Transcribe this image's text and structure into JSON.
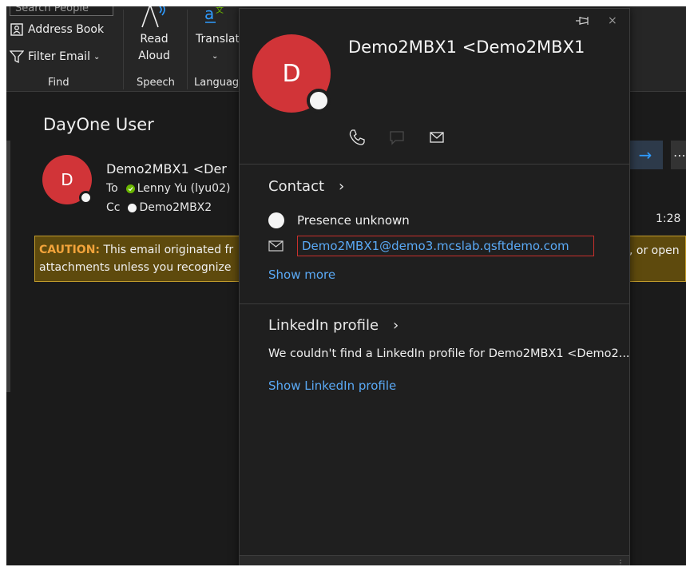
{
  "ribbon": {
    "search_placeholder": "Search People",
    "address_book": "Address Book",
    "filter_email": "Filter Email",
    "group_find": "Find",
    "read_aloud_1": "Read",
    "read_aloud_2": "Aloud",
    "group_speech": "Speech",
    "translate": "Translat",
    "group_language": "Languag"
  },
  "message": {
    "subject": "DayOne User",
    "sender_initial": "D",
    "sender_name": "Demo2MBX1 <Der",
    "to_label": "To",
    "to_value": "Lenny Yu (lyu02)",
    "cc_label": "Cc",
    "cc_value": "Demo2MBX2",
    "time": "1:28",
    "caution_lead": "CAUTION:",
    "caution_text1": " This email originated fr",
    "caution_text2": "attachments unless you recognize",
    "caution_right": ", or open"
  },
  "card": {
    "initial": "D",
    "name": "Demo2MBX1 <Demo2MBX1",
    "contact_title": "Contact",
    "presence": "Presence unknown",
    "email": "Demo2MBX1@demo3.mcslab.qsftdemo.com",
    "show_more": "Show more",
    "linkedin_title": "LinkedIn profile",
    "linkedin_text": "We couldn't find a LinkedIn profile for Demo2MBX1 <Demo2...",
    "show_linkedin": "Show LinkedIn profile"
  },
  "colors": {
    "avatar": "#d13438",
    "link": "#5aa9f5",
    "highlight_border": "#c8302c",
    "caution_bg": "#5e4a0d"
  }
}
